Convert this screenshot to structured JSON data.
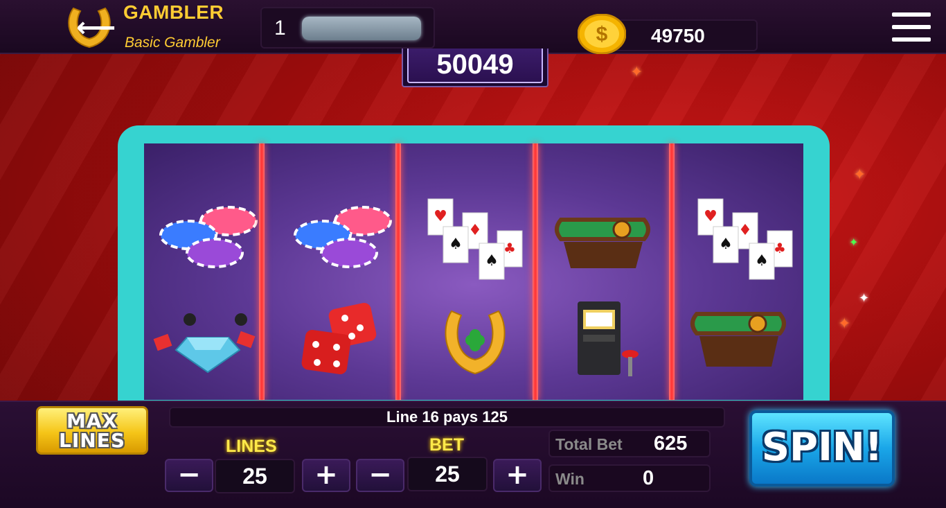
{
  "header": {
    "brand": "GAMBLER",
    "rank": "Basic Gambler",
    "level": "1",
    "coins": "49750",
    "icons": {
      "logo": "horseshoe-icon",
      "back": "back-arrow-icon",
      "coin": "dollar-coin-icon",
      "menu": "hamburger-menu-icon"
    }
  },
  "jackpot": "50049",
  "reels": [
    [
      "chips-icon",
      "diamond-cards-icon"
    ],
    [
      "chips-icon",
      "dice-icon"
    ],
    [
      "playing-cards-icon",
      "horseshoe-clover-icon"
    ],
    [
      "roulette-table-icon",
      "slot-machine-icon"
    ],
    [
      "playing-cards-icon",
      "roulette-table-icon"
    ]
  ],
  "controls": {
    "max_lines": "MAX\nLINES",
    "max_lines_line1": "MAX",
    "max_lines_line2": "LINES",
    "pay_message": "Line 16 pays 125",
    "lines_label": "LINES",
    "lines_value": "25",
    "bet_label": "BET",
    "bet_value": "25",
    "minus": "−",
    "plus": "+",
    "total_bet_label": "Total Bet",
    "total_bet_value": "625",
    "win_label": "Win",
    "win_value": "0",
    "spin": "SPIN!"
  },
  "colors": {
    "brand_gold": "#ffcc33",
    "reel_frame": "#36d3d0",
    "spin_blue": "#1aa6e8",
    "background_red": "#a40d0d"
  }
}
